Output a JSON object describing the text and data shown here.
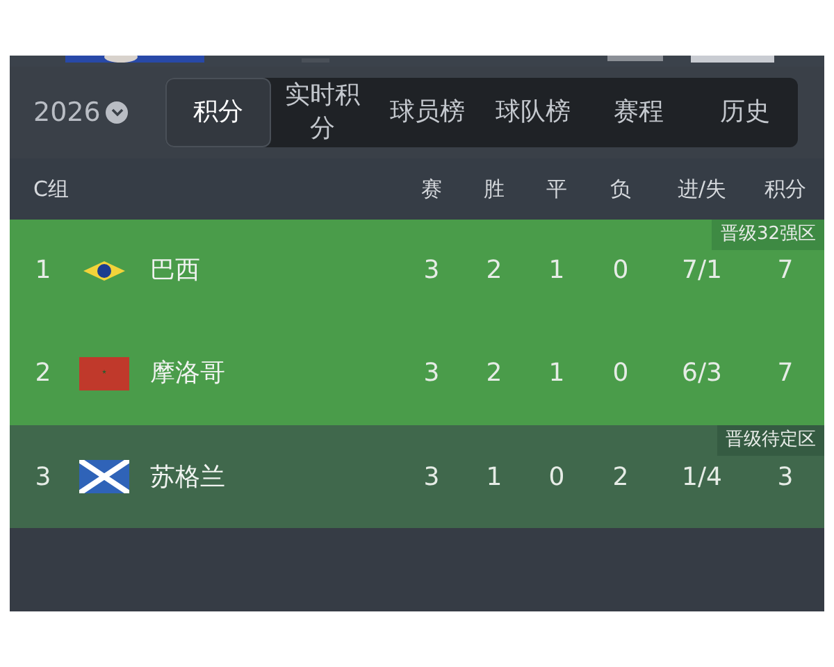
{
  "season": {
    "year": "2026"
  },
  "tabs": [
    {
      "label": "积分",
      "selected": true
    },
    {
      "label": "实时积分",
      "selected": false
    },
    {
      "label": "球员榜",
      "selected": false
    },
    {
      "label": "球队榜",
      "selected": false
    },
    {
      "label": "赛程",
      "selected": false
    },
    {
      "label": "历史",
      "selected": false
    }
  ],
  "table": {
    "group": "C组",
    "columns": [
      "赛",
      "胜",
      "平",
      "负",
      "进/失",
      "积分"
    ],
    "rows": [
      {
        "kind": "advance",
        "zone_label": "晋级32强区",
        "rank": "1",
        "flag": {
          "kind": "brazil"
        },
        "team": "巴西",
        "stats": [
          "3",
          "2",
          "1",
          "0",
          "7/1",
          "7"
        ]
      },
      {
        "kind": "advance",
        "rank": "2",
        "flag": {
          "kind": "morocco"
        },
        "team": "摩洛哥",
        "stats": [
          "3",
          "2",
          "1",
          "0",
          "6/3",
          "7"
        ]
      },
      {
        "kind": "pending",
        "zone_label": "晋级待定区",
        "rank": "3",
        "flag": {
          "kind": "scotland"
        },
        "team": "苏格兰",
        "stats": [
          "3",
          "1",
          "0",
          "2",
          "1/4",
          "3"
        ]
      },
      {
        "kind": "out"
      }
    ]
  }
}
